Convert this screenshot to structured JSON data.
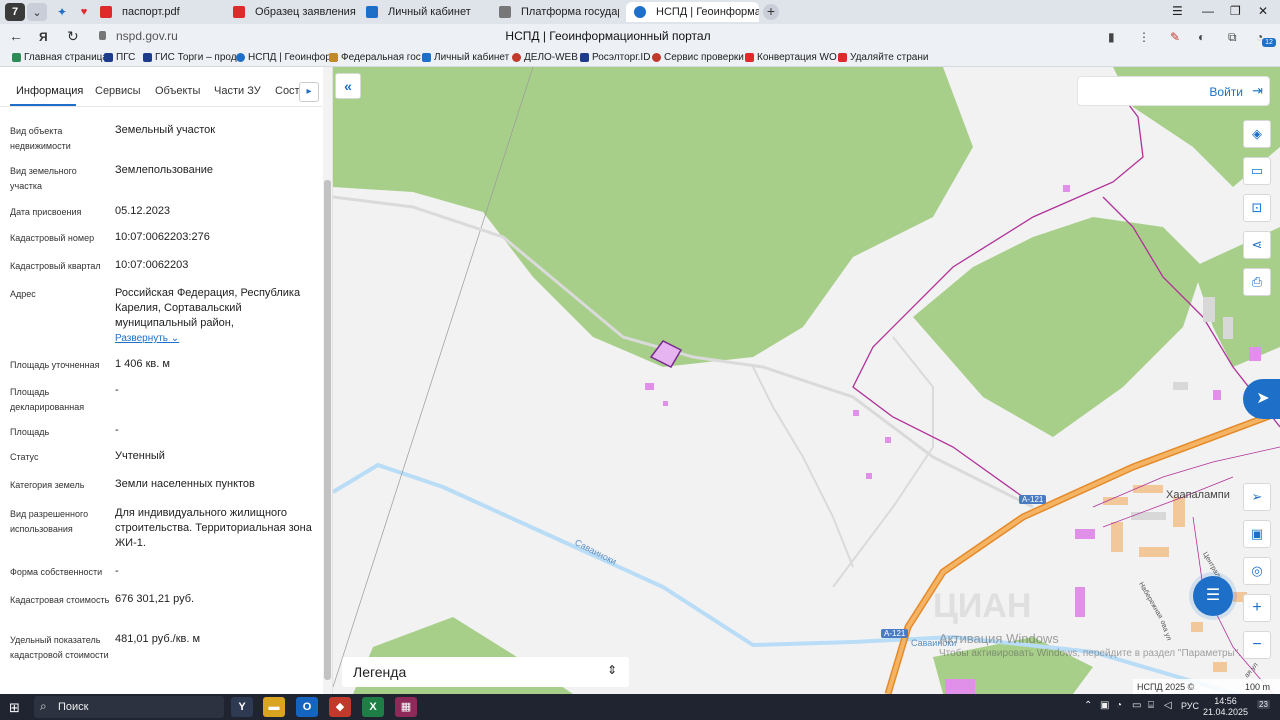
{
  "browser": {
    "tabs": [
      {
        "title": "паспорт.pdf",
        "color": "#e0292b"
      },
      {
        "title": "Образец заявления о на",
        "color": "#e0292b"
      },
      {
        "title": "Личный кабинет",
        "color": "#1d6fc8"
      },
      {
        "title": "Платформа государстве",
        "color": "#555555"
      },
      {
        "title": "НСПД | Геоинформаци",
        "color": "#1d6fc8",
        "active": true
      }
    ],
    "url": "nspd.gov.ru",
    "page_title": "НСПД | Геоинформационный портал",
    "ext_badge": "12",
    "logo": "7",
    "bookmarks": [
      {
        "title": "Главная страница",
        "color": "#2e8b57"
      },
      {
        "title": "ПГС",
        "color": "#1d3c8c"
      },
      {
        "title": "ГИС Торги – прод",
        "color": "#1d3c8c"
      },
      {
        "title": "НСПД | Геоинфор",
        "color": "#1d6fc8"
      },
      {
        "title": "Федеральная гос",
        "color": "#c08a2b"
      },
      {
        "title": "Личный кабинет",
        "color": "#1d6fc8"
      },
      {
        "title": "ДЕЛО-WEB",
        "color": "#c0392b"
      },
      {
        "title": "Росэлторг.ID",
        "color": "#1d3c8c"
      },
      {
        "title": "Сервис проверки",
        "color": "#c0392b"
      },
      {
        "title": "Конвертация WO",
        "color": "#e0292b"
      },
      {
        "title": "Удаляйте страни",
        "color": "#e0292b"
      }
    ]
  },
  "panel": {
    "tabs": [
      "Информация",
      "Сервисы",
      "Объекты",
      "Части ЗУ",
      "Соста"
    ],
    "rows": [
      {
        "label": "Вид объекта недвижимости",
        "value": "Земельный участок"
      },
      {
        "label": "Вид земельного участка",
        "value": "Землепользование"
      },
      {
        "label": "Дата присвоения",
        "value": "05.12.2023"
      },
      {
        "label": "Кадастровый номер",
        "value": "10:07:0062203:276"
      },
      {
        "label": "Кадастровый квартал",
        "value": "10:07:0062203"
      },
      {
        "label": "Адрес",
        "value": "Российская Федерация, Республика Карелия, Сортавальский муниципальный район,"
      },
      {
        "label": "Площадь уточненная",
        "value": "1 406 кв. м"
      },
      {
        "label": "Площадь декларированная",
        "value": "-"
      },
      {
        "label": "Площадь",
        "value": "-"
      },
      {
        "label": "Статус",
        "value": "Учтенный"
      },
      {
        "label": "Категория земель",
        "value": "Земли населенных пунктов"
      },
      {
        "label": "Вид разрешенного использования",
        "value": "Для индивидуального жилищного строительства. Территориальная зона ЖИ-1."
      },
      {
        "label": "Форма собственности",
        "value": "-"
      },
      {
        "label": "Кадастровая стоимость",
        "value": "676 301,21 руб."
      },
      {
        "label": "Удельный показатель кадастровой стоимости",
        "value": "481,01 руб./кв. м"
      }
    ],
    "expand_label": "Развернуть"
  },
  "map": {
    "login_label": "Войти",
    "legend_label": "Легенда",
    "place_name": "Хаапалампи",
    "river_name": "Саваиноки",
    "river_name2": "Саваиноки",
    "road_label": "А-121",
    "road_label2": "А-121",
    "street1": "Набережная",
    "street2": "Центральная ул",
    "street3": "ова ул",
    "street4": "ая ул",
    "copyright": "НСПД 2025 ©",
    "scale": "100 m",
    "watermark": "ЦИАН",
    "activation_title": "Активация Windows",
    "activation_text": "Чтобы активировать Windows, перейдите в раздел \"Параметры\"."
  },
  "taskbar": {
    "search_label": "Поиск",
    "lang": "РУС",
    "time": "14:56",
    "date": "21.04.2025",
    "notifications": "23"
  },
  "colors": {
    "accent": "#1d6fc8",
    "forest": "#a8cf8a",
    "parcel": "#e6b4f0",
    "highway": "#f2a144",
    "river": "#b9dcf7"
  }
}
